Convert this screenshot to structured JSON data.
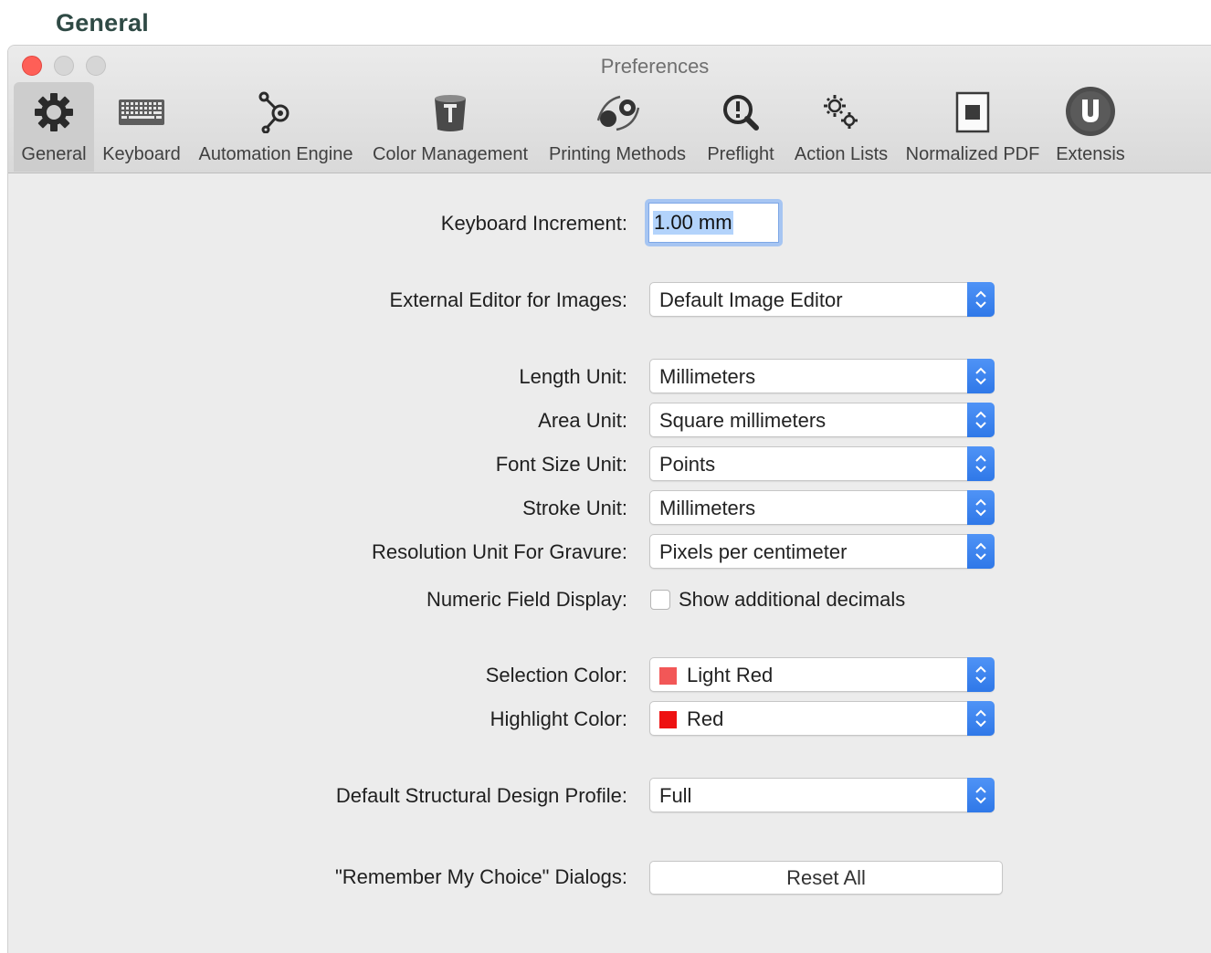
{
  "doc": {
    "heading": "General"
  },
  "window": {
    "title": "Preferences"
  },
  "toolbar": {
    "items": [
      {
        "label": "General",
        "icon": "gear-icon",
        "selected": true
      },
      {
        "label": "Keyboard",
        "icon": "keyboard-icon"
      },
      {
        "label": "Automation Engine",
        "icon": "automation-engine-icon"
      },
      {
        "label": "Color Management",
        "icon": "color-management-icon"
      },
      {
        "label": "Printing Methods",
        "icon": "printing-methods-icon"
      },
      {
        "label": "Preflight",
        "icon": "preflight-icon"
      },
      {
        "label": "Action Lists",
        "icon": "action-lists-icon"
      },
      {
        "label": "Normalized PDF",
        "icon": "normalized-pdf-icon"
      },
      {
        "label": "Extensis",
        "icon": "extensis-icon"
      }
    ]
  },
  "form": {
    "keyboard_increment": {
      "label": "Keyboard Increment:",
      "value": "1.00 mm"
    },
    "external_editor": {
      "label": "External Editor for Images:",
      "value": "Default Image Editor"
    },
    "length_unit": {
      "label": "Length Unit:",
      "value": "Millimeters"
    },
    "area_unit": {
      "label": "Area Unit:",
      "value": "Square millimeters"
    },
    "font_size_unit": {
      "label": "Font Size Unit:",
      "value": "Points"
    },
    "stroke_unit": {
      "label": "Stroke Unit:",
      "value": "Millimeters"
    },
    "resolution_unit": {
      "label": "Resolution Unit For Gravure:",
      "value": "Pixels per centimeter"
    },
    "numeric_field_display": {
      "label": "Numeric Field Display:",
      "checkbox_label": "Show additional decimals",
      "checked": false
    },
    "selection_color": {
      "label": "Selection Color:",
      "value": "Light Red",
      "swatch": "#f25757"
    },
    "highlight_color": {
      "label": "Highlight Color:",
      "value": "Red",
      "swatch": "#ee1111"
    },
    "structural_profile": {
      "label": "Default Structural Design Profile:",
      "value": "Full"
    },
    "remember_choice": {
      "label": "\"Remember My Choice\" Dialogs:",
      "button_label": "Reset All"
    }
  },
  "colors": {
    "accent": "#3b82f0",
    "close": "#fe5f57"
  }
}
